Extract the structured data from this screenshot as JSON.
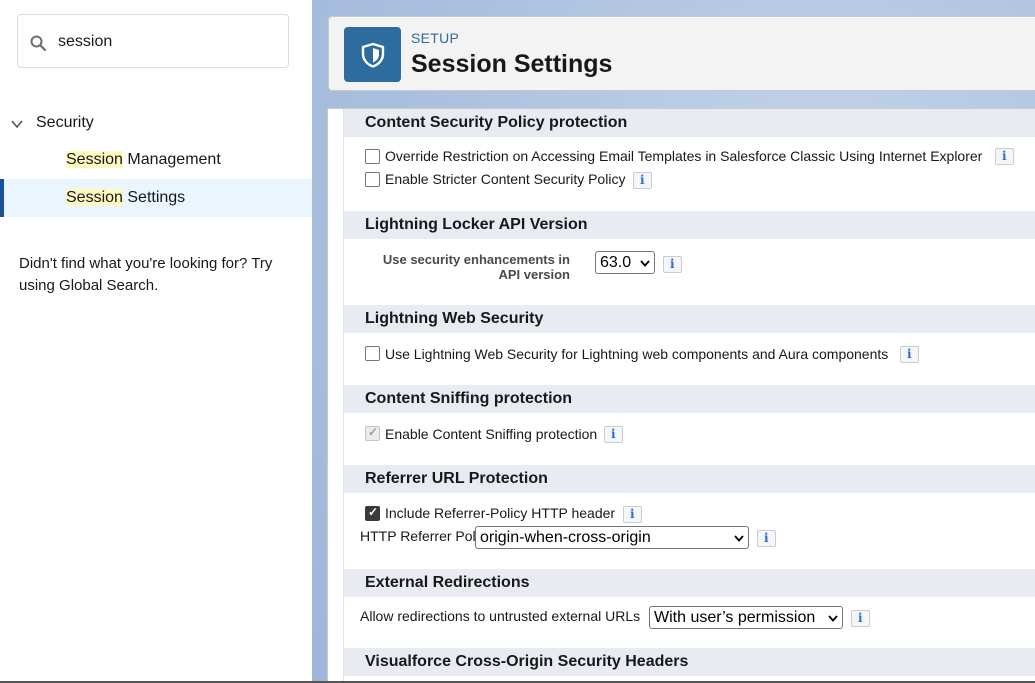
{
  "sidebar": {
    "search": {
      "value": "session"
    },
    "tree": {
      "section_label": "Security",
      "items": [
        {
          "highlight": "Session",
          "rest": " Management"
        },
        {
          "highlight": "Session",
          "rest": " Settings"
        }
      ]
    },
    "not_found_text": "Didn't find what you're looking for? Try using Global Search."
  },
  "header": {
    "kicker": "SETUP",
    "title": "Session Settings",
    "icon": "shield-icon"
  },
  "sections": {
    "csp": {
      "title": "Content Security Policy protection",
      "options": [
        {
          "label": "Override Restriction on Accessing Email Templates in Salesforce Classic Using Internet Explorer",
          "checked": false
        },
        {
          "label": "Enable Stricter Content Security Policy",
          "checked": false
        }
      ]
    },
    "locker": {
      "title": "Lightning Locker API Version",
      "field_label": "Use security enhancements in API version",
      "selected": "63.0"
    },
    "lws": {
      "title": "Lightning Web Security",
      "option": {
        "label": "Use Lightning Web Security for Lightning web components and Aura components",
        "checked": false
      }
    },
    "sniffing": {
      "title": "Content Sniffing protection",
      "option": {
        "label": "Enable Content Sniffing protection",
        "checked": true,
        "disabled": true
      }
    },
    "referrer": {
      "title": "Referrer URL Protection",
      "option": {
        "label": "Include Referrer-Policy HTTP header",
        "checked": true
      },
      "policy_label": "HTTP Referrer Policy:",
      "policy_selected": "origin-when-cross-origin"
    },
    "redirect": {
      "title": "External Redirections",
      "label": "Allow redirections to untrusted external URLs",
      "selected": "With user’s permission"
    },
    "vf": {
      "title": "Visualforce Cross-Origin Security Headers"
    }
  },
  "colors": {
    "accent": "#2e6b9e",
    "selected_bg": "#eaf5fe",
    "highlight": "#fdf9c0"
  }
}
